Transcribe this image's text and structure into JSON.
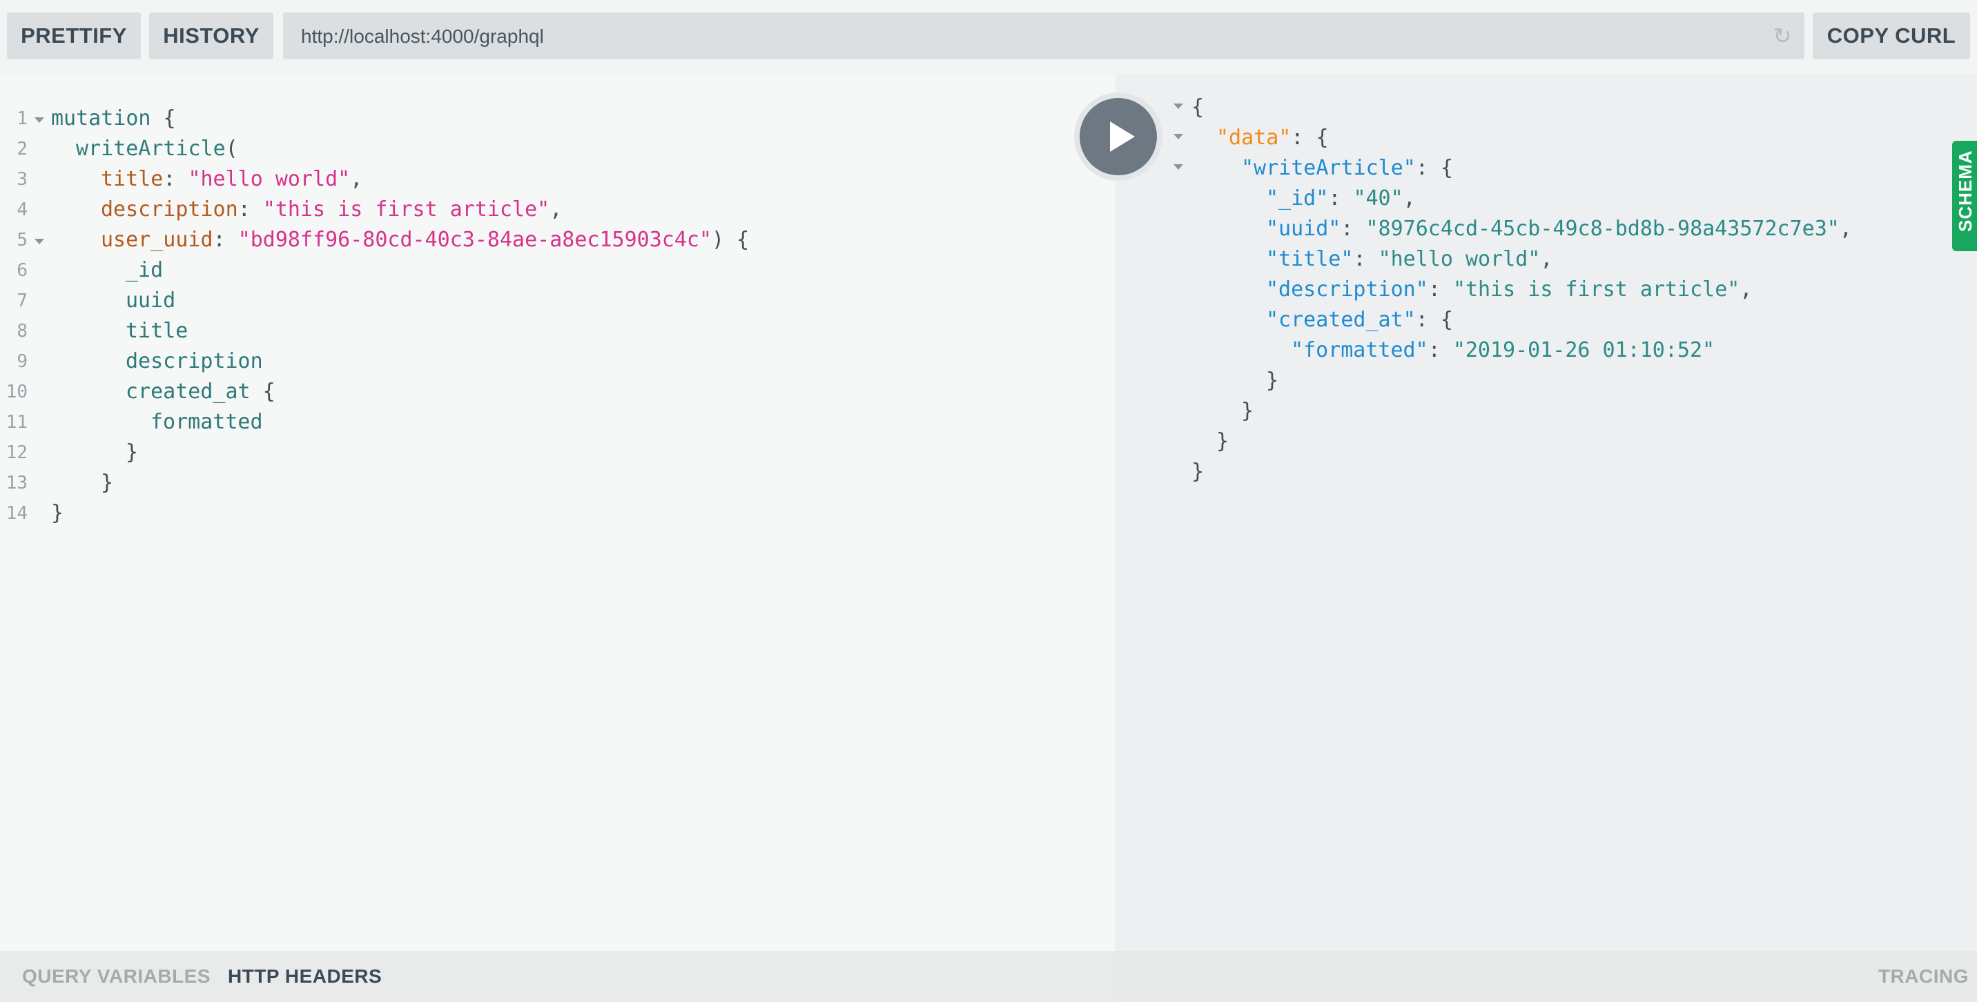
{
  "toolbar": {
    "prettify": "PRETTIFY",
    "history": "HISTORY",
    "endpoint": "http://localhost:4000/graphql",
    "copy_curl": "COPY CURL"
  },
  "editor": {
    "line_numbers": [
      "1",
      "2",
      "3",
      "4",
      "5",
      "6",
      "7",
      "8",
      "9",
      "10",
      "11",
      "12",
      "13",
      "14"
    ],
    "tokens": {
      "mutation": "mutation",
      "open_brace": " {",
      "write_article": "writeArticle",
      "open_paren": "(",
      "title_key": "title",
      "title_val": "\"hello world\"",
      "desc_key": "description",
      "desc_val": "\"this is first article\"",
      "uuid_key": "user_uuid",
      "uuid_val": "\"bd98ff96-80cd-40c3-84ae-a8ec15903c4c\"",
      "close_paren_brace": ") {",
      "colon": ": ",
      "comma": ",",
      "f_id": "_id",
      "f_uuid": "uuid",
      "f_title": "title",
      "f_desc": "description",
      "f_created": "created_at",
      "f_formatted": "formatted",
      "close_brace": "}"
    }
  },
  "result": {
    "open": "{",
    "data_key": "\"data\"",
    "write_key": "\"writeArticle\"",
    "id_key": "\"_id\"",
    "id_val": "\"40\"",
    "uuid_key": "\"uuid\"",
    "uuid_val": "\"8976c4cd-45cb-49c8-bd8b-98a43572c7e3\"",
    "title_key": "\"title\"",
    "title_val": "\"hello world\"",
    "desc_key": "\"description\"",
    "desc_val": "\"this is first article\"",
    "created_key": "\"created_at\"",
    "formatted_key": "\"formatted\"",
    "formatted_val": "\"2019-01-26 01:10:52\"",
    "colon": ": ",
    "comma": ",",
    "brace_open": "{",
    "brace_close": "}"
  },
  "sidebar": {
    "schema": "SCHEMA"
  },
  "bottom": {
    "query_variables": "QUERY VARIABLES",
    "http_headers": "HTTP HEADERS",
    "tracing": "TRACING"
  },
  "colors": {
    "accent": "#18a85d",
    "play_button": "#6d7882",
    "json_key": "#1f8bd0",
    "json_string": "#2a8b88",
    "graphql_arg": "#b55a1f",
    "graphql_string": "#d6338a"
  },
  "icons": [
    "play-icon",
    "reload-icon",
    "fold-arrow-icon"
  ]
}
